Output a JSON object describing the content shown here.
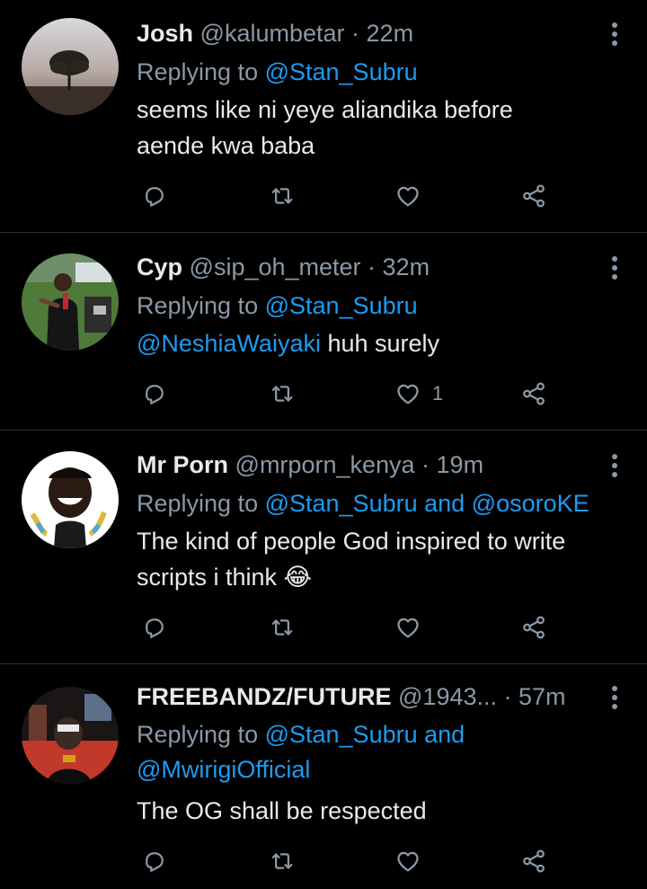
{
  "tweets": [
    {
      "name": "Josh",
      "handle": "@kalumbetar",
      "time": "22m",
      "replying_prefix": "Replying to ",
      "replying_to": "@Stan_Subru",
      "replying_conj": "",
      "replying_to_2": "",
      "text_mention": "",
      "text_line1": "seems like ni yeye aliandika before",
      "text_line2": "aende kwa baba",
      "likes": ""
    },
    {
      "name": "Cyp",
      "handle": "@sip_oh_meter",
      "time": "32m",
      "replying_prefix": "Replying to ",
      "replying_to": "@Stan_Subru",
      "replying_conj": "",
      "replying_to_2": "",
      "text_mention": "@NeshiaWaiyaki",
      "text_line1": " huh surely",
      "text_line2": "",
      "likes": "1"
    },
    {
      "name": "Mr Porn",
      "handle": "@mrporn_kenya",
      "time": "19m",
      "replying_prefix": "Replying to ",
      "replying_to": "@Stan_Subru",
      "replying_conj": " and ",
      "replying_to_2": "@osoroKE",
      "text_mention": "",
      "text_line1": "The kind of people God inspired to write",
      "text_line2": "scripts i think 😂",
      "likes": ""
    },
    {
      "name": "FREEBANDZ/FUTURE",
      "handle": "@1943...",
      "time": "57m",
      "replying_prefix": "Replying to ",
      "replying_to": "@Stan_Subru",
      "replying_conj": " and",
      "replying_to_2": "@MwirigiOfficial",
      "text_mention": "",
      "text_line1": "The OG shall be respected",
      "text_line2": "",
      "likes": ""
    }
  ],
  "separator": " · ",
  "icons": [
    "reply-icon",
    "retweet-icon",
    "like-icon",
    "share-icon",
    "more-icon"
  ],
  "colors": {
    "background": "#000000",
    "text": "#e7e9ea",
    "muted": "#8b98a5",
    "link": "#1d9bf0"
  }
}
